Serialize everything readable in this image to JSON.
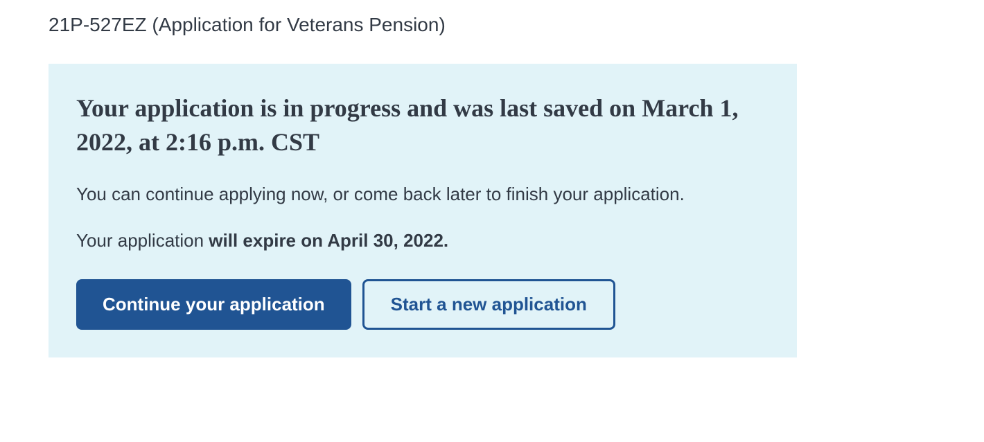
{
  "form": {
    "label": "21P-527EZ (Application for Veterans Pension)"
  },
  "alert": {
    "heading": "Your application is in progress and was last saved on March 1, 2022, at 2:16 p.m. CST",
    "continue_text": "You can continue applying now, or come back later to finish your application.",
    "expire_prefix": "Your application ",
    "expire_bold": "will expire on April 30, 2022."
  },
  "buttons": {
    "continue": "Continue your application",
    "start_new": "Start a new application"
  }
}
